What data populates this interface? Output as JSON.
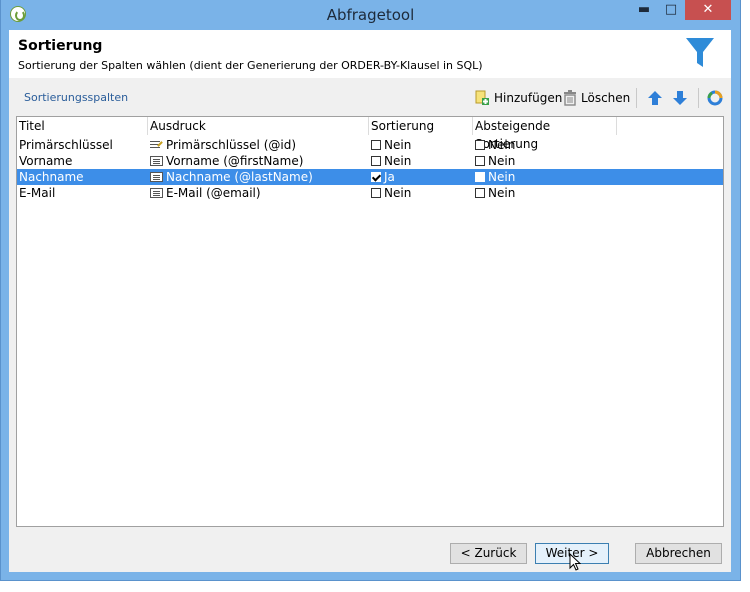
{
  "window": {
    "title": "Abfragetool",
    "min_glyph": "▬",
    "max_glyph": "□",
    "close_glyph": "✕"
  },
  "header": {
    "title": "Sortierung",
    "subtitle": "Sortierung der Spalten wählen (dient der Generierung der ORDER-BY-Klausel in SQL)"
  },
  "toolbar": {
    "section_label": "Sortierungsspalten",
    "add_label": "Hinzufügen",
    "delete_label": "Löschen"
  },
  "grid": {
    "columns": [
      "Titel",
      "Ausdruck",
      "Sortierung",
      "Absteigende Sortierung"
    ],
    "rows": [
      {
        "title": "Primärschlüssel",
        "expression": "Primärschlüssel (@id)",
        "sort": "Nein",
        "sort_checked": false,
        "desc": "Nein",
        "desc_checked": false
      },
      {
        "title": "Vorname",
        "expression": "Vorname (@firstName)",
        "sort": "Nein",
        "sort_checked": false,
        "desc": "Nein",
        "desc_checked": false
      },
      {
        "title": "Nachname",
        "expression": "Nachname (@lastName)",
        "sort": "Ja",
        "sort_checked": true,
        "desc": "Nein",
        "desc_checked": false
      },
      {
        "title": "E-Mail",
        "expression": "E-Mail (@email)",
        "sort": "Nein",
        "sort_checked": false,
        "desc": "Nein",
        "desc_checked": false
      }
    ],
    "selected_row": 2
  },
  "footer": {
    "back_label": "< Zurück",
    "next_label": "Weiter >",
    "cancel_label": "Abbrechen"
  },
  "colors": {
    "accent": "#3d8ee8",
    "titlebar": "#7ab3e8",
    "funnel": "#2e8bd8"
  }
}
